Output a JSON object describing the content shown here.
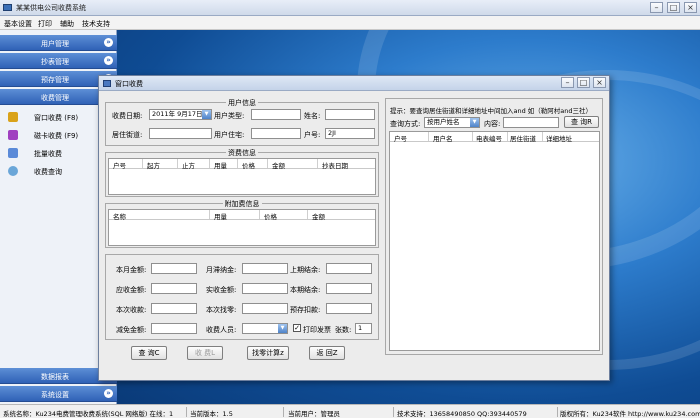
{
  "window": {
    "title": "某某供电公司收费系统"
  },
  "menu": [
    "基本设置",
    "打印",
    "辅助",
    "技术支持"
  ],
  "sidebar": {
    "groups": [
      "用户管理",
      "抄表管理",
      "预存管理",
      "收费管理"
    ],
    "items": [
      {
        "label": "窗口收费 (F8)",
        "icon": "pencil-icon",
        "color": "#d9a21a"
      },
      {
        "label": "磁卡收费 (F9)",
        "icon": "card-icon",
        "color": "#a040c0"
      },
      {
        "label": "批量收费",
        "icon": "document-icon",
        "color": "#5a8ad8"
      },
      {
        "label": "收费查询",
        "icon": "search-users-icon",
        "color": "#6aa6d8"
      }
    ],
    "bottom_groups": [
      "数据报表",
      "系统设置"
    ]
  },
  "dialog": {
    "title": "窗口收费",
    "user_info": {
      "title": "用户信息",
      "date_label": "收费日期:",
      "date_value": "2011年 9月17日",
      "user_type_label": "用户类型:",
      "name_label": "姓名:",
      "street_label": "居住街道:",
      "address_label": "用户住宅:",
      "house_label": "户号:",
      "house_value": "2JI"
    },
    "billing": {
      "title": "资费信息",
      "columns": [
        "户号",
        "起方",
        "止方",
        "用量",
        "价格",
        "金额",
        "抄表日期"
      ]
    },
    "extra": {
      "title": "附加费信息",
      "columns": [
        "名称",
        "用量",
        "价格",
        "金额"
      ]
    },
    "totals": {
      "month_amount": "本月金额:",
      "month_late": "月滞纳金:",
      "prev_balance": "上期结余:",
      "due_amount": "应收金额:",
      "actual_amount": "实收金额:",
      "this_balance": "本期结余:",
      "this_received": "本次收款:",
      "this_change": "本次找零:",
      "prepay_deduct": "预存扣款:",
      "discount_amount": "减免金额:",
      "cashier": "收费人员:",
      "print_invoice": "打印发票",
      "copies_label": "张数:",
      "copies_value": "1"
    },
    "buttons": {
      "query": "查 询C",
      "charge": "收 费L",
      "calc_change": "找零计算z",
      "back": "返 回Z"
    },
    "hint": "提示：要查询居住街道和详细地址中间加入and 如（勒阿村and三社）",
    "query": {
      "mode_label": "查询方式:",
      "mode_value": "按用户姓名",
      "content_label": "内容:",
      "button": "查 询R",
      "columns": [
        "户号",
        "用户名",
        "电表编号",
        "居住街道",
        "详细地址"
      ]
    }
  },
  "status": {
    "system": "系统名称：Ku234电费管理收费系统(SQL 网络版) 在线：1",
    "version": "当前版本：1.5",
    "operator": "当前用户：管理员",
    "support": "技术支持：13658490850 QQ:393440579",
    "copyright": "版权所有：Ku234软件 http://www.ku234.com/"
  }
}
